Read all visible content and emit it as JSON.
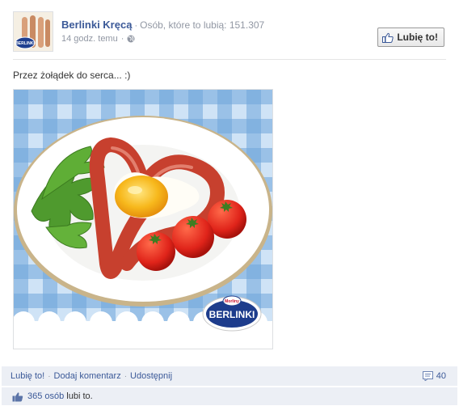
{
  "page": {
    "name": "Berlinki Kręcą",
    "likes_label": "Osób, które to lubią: 151.307",
    "time": "14 godz. temu",
    "like_button": "Lubię to!",
    "avatar_logo_text": "BERLINKI"
  },
  "post": {
    "text": "Przez żołądek do serca... :)",
    "photo_logo_text": "BERLINKI",
    "photo_brand_small": "Morliny"
  },
  "actions": {
    "like": "Lubię to!",
    "comment": "Dodaj komentarz",
    "share": "Udostępnij",
    "comments_count": "40"
  },
  "likes_summary": {
    "count_link": "365 osób",
    "suffix": "lubi to."
  },
  "icons": {
    "thumb": "thumbs-up-icon",
    "globe": "globe-icon",
    "comment": "comment-icon"
  },
  "colors": {
    "link": "#3b5998",
    "meta_gray": "#9197a3",
    "bar_bg": "#eceff5"
  }
}
